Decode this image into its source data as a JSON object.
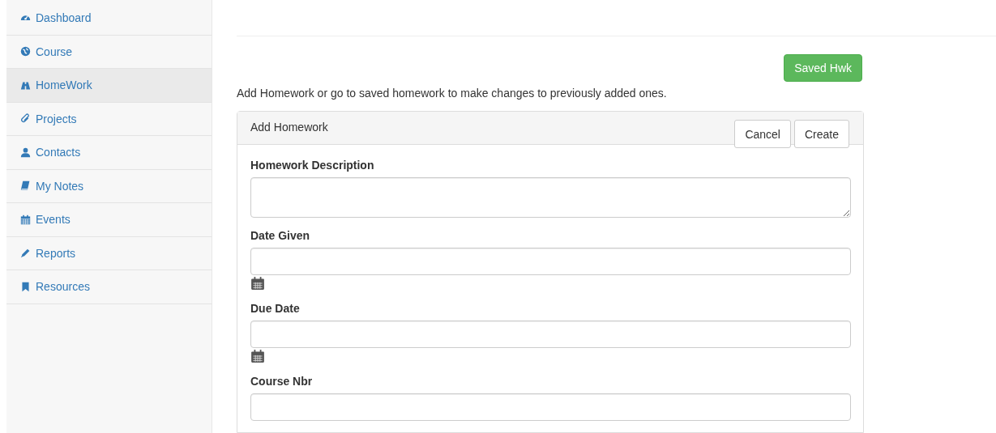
{
  "sidebar": {
    "items": [
      {
        "label": "Dashboard",
        "selected": false
      },
      {
        "label": "Course",
        "selected": false
      },
      {
        "label": "HomeWork",
        "selected": true
      },
      {
        "label": "Projects",
        "selected": false
      },
      {
        "label": "Contacts",
        "selected": false
      },
      {
        "label": "My Notes",
        "selected": false
      },
      {
        "label": "Events",
        "selected": false
      },
      {
        "label": "Reports",
        "selected": false
      },
      {
        "label": "Resources",
        "selected": false
      }
    ]
  },
  "saved_button": "Saved Hwk",
  "intro": "Add Homework or go to saved homework to make changes to previously added ones.",
  "panel": {
    "title": "Add Homework",
    "buttons": [
      "Cancel",
      "Create"
    ],
    "fields": [
      {
        "label": "Homework Description",
        "kind": "textarea"
      },
      {
        "label": "Date Given",
        "kind": "date"
      },
      {
        "label": "Due Date",
        "kind": "date"
      },
      {
        "label": "Course Nbr",
        "kind": "text"
      }
    ]
  }
}
